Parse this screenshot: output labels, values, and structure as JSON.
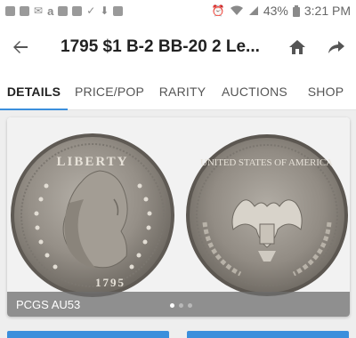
{
  "status_bar": {
    "battery": "43%",
    "time": "3:21 PM",
    "left_icons": [
      "email-icon",
      "email-icon",
      "mail-icon",
      "amazon-icon",
      "image-icon",
      "image-icon",
      "check-icon",
      "download-icon",
      "camera-icon"
    ],
    "right_icons": [
      "alarm-icon",
      "wifi-icon",
      "signal-icon",
      "battery-icon"
    ]
  },
  "app_bar": {
    "title": "1795 $1 B-2 BB-20 2 Le...",
    "back_icon": "arrow-back-icon",
    "home_icon": "home-icon",
    "share_icon": "share-icon"
  },
  "tabs": [
    {
      "label": "DETAILS",
      "active": true
    },
    {
      "label": "PRICE/POP",
      "active": false
    },
    {
      "label": "RARITY",
      "active": false
    },
    {
      "label": "AUCTIONS",
      "active": false
    },
    {
      "label": "SHOP",
      "active": false
    }
  ],
  "gallery": {
    "caption": "PCGS AU53",
    "obverse_legend": "LIBERTY",
    "obverse_date": "1795",
    "reverse_legend": "UNITED STATES OF AMERICA",
    "page_count": 3,
    "current_page": 1
  },
  "colors": {
    "accent": "#3b8fdc",
    "coin_silver": "#9a948c",
    "coin_dark": "#6e6962",
    "caption_bg": "#6e6e6e"
  }
}
